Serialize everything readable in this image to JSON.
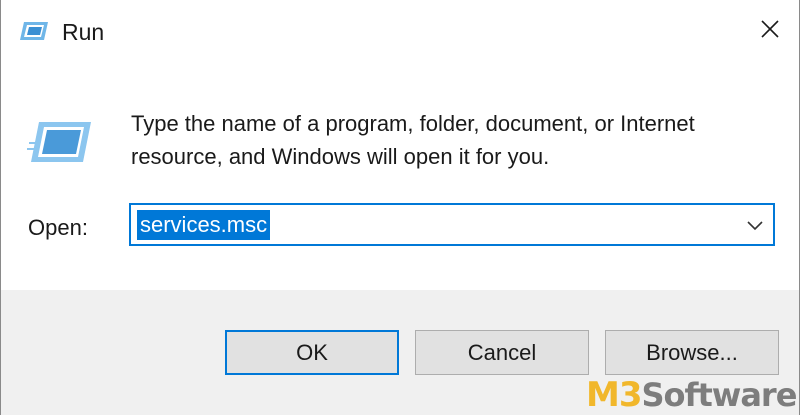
{
  "window": {
    "title": "Run",
    "close_icon": "close-icon",
    "title_icon": "run-icon"
  },
  "main": {
    "description": "Type the name of a program, folder, document, or Internet resource, and Windows will open it for you.",
    "open_label": "Open:",
    "open_value": "services.msc",
    "dropdown_icon": "chevron-down-icon"
  },
  "buttons": {
    "ok": "OK",
    "cancel": "Cancel",
    "browse": "Browse..."
  },
  "watermark": {
    "part_a": "M3",
    "part_b": " Software"
  },
  "colors": {
    "accent": "#0078d7",
    "footer_bg": "#f0f0f0",
    "button_bg": "#e1e1e1",
    "watermark_gold": "#f1b72b",
    "watermark_gray": "#7d7d7d"
  }
}
